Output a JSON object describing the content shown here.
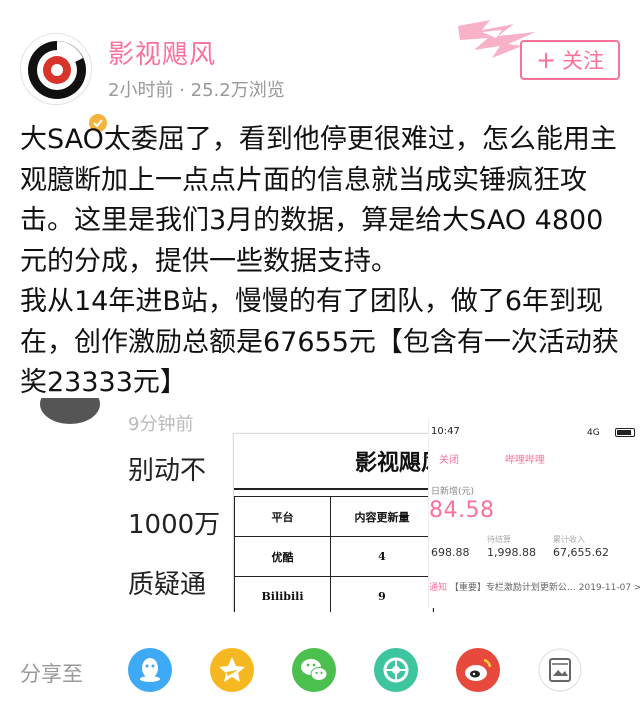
{
  "post": {
    "author": "影视飓风",
    "meta": "2小时前 · 25.2万浏览",
    "follow_plus": "+",
    "follow_label": "关注"
  },
  "content": {
    "paragraph1": "大SAO太委屈了，看到他停更很难过，怎么能用主观臆断加上一点点片面的信息就当成实锤疯狂攻击。这里是我们3月的数据，算是给大SAO 4800元的分成，提供一些数据支持。",
    "paragraph2": "我从14年进B站，慢慢的有了团队，做了6年到现在，创作激励总额是67655元【包含有一次活动获奖23333元】"
  },
  "image": {
    "background_post": {
      "time": "9分钟前",
      "lines": [
        "别动不",
        "1000万",
        "质疑通"
      ]
    },
    "table": {
      "title": "影视飓风",
      "header": [
        "平台",
        "内容更新量"
      ],
      "rows": [
        [
          "优酷",
          "4"
        ],
        [
          "Bilibili",
          "9"
        ]
      ]
    },
    "phone": {
      "time": "10:47",
      "signal": "4G",
      "close": "关闭",
      "app_name": "哔哩哔哩",
      "new_label": "日新增(元)",
      "big_value": "84.58",
      "stats": [
        {
          "label": "",
          "value": "698.88"
        },
        {
          "label": "待结算",
          "value": "1,998.88"
        },
        {
          "label": "累计收入",
          "value": "67,655.62"
        }
      ],
      "notice_tag": "通知",
      "notice_text": "【重要】专栏激励计划更新公…  2019-11-07 >"
    }
  },
  "share": {
    "label": "分享至",
    "targets": [
      {
        "name": "qq-icon",
        "color": "#3ea9f5"
      },
      {
        "name": "qzone-icon",
        "color": "#f6b820"
      },
      {
        "name": "wechat-icon",
        "color": "#4cc04f"
      },
      {
        "name": "moments-icon",
        "color": "#3ec5a0"
      },
      {
        "name": "weibo-icon",
        "color": "#e8493d"
      },
      {
        "name": "dynamic-icon",
        "color": "#ffffff"
      }
    ]
  },
  "colors": {
    "accent": "#fb7299",
    "meta_gray": "#999999",
    "text": "#111111"
  }
}
